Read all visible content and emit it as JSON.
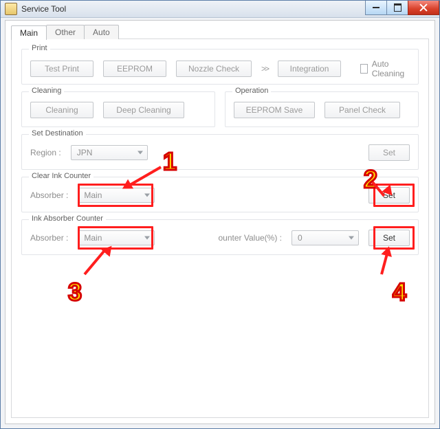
{
  "window": {
    "title": "Service Tool"
  },
  "tabs": {
    "main": "Main",
    "other": "Other",
    "auto": "Auto"
  },
  "print": {
    "legend": "Print",
    "test": "Test Print",
    "eeprom": "EEPROM",
    "nozzle": "Nozzle Check",
    "integration": "Integration",
    "auto_cleaning": "Auto Cleaning"
  },
  "cleaning": {
    "legend": "Cleaning",
    "cleaning": "Cleaning",
    "deep": "Deep Cleaning"
  },
  "operation": {
    "legend": "Operation",
    "save": "EEPROM Save",
    "panel": "Panel Check"
  },
  "dest": {
    "legend": "Set Destination",
    "region_label": "Region :",
    "region_value": "JPN",
    "set": "Set"
  },
  "clear": {
    "legend": "Clear Ink Counter",
    "absorber_label": "Absorber :",
    "absorber_value": "Main",
    "set": "Set"
  },
  "inkabs": {
    "legend": "Ink Absorber Counter",
    "absorber_label": "Absorber :",
    "absorber_value": "Main",
    "counter_label": "ounter Value(%) :",
    "counter_value": "0",
    "set": "Set"
  },
  "annot": {
    "n1": "1",
    "n2": "2",
    "n3": "3",
    "n4": "4"
  }
}
